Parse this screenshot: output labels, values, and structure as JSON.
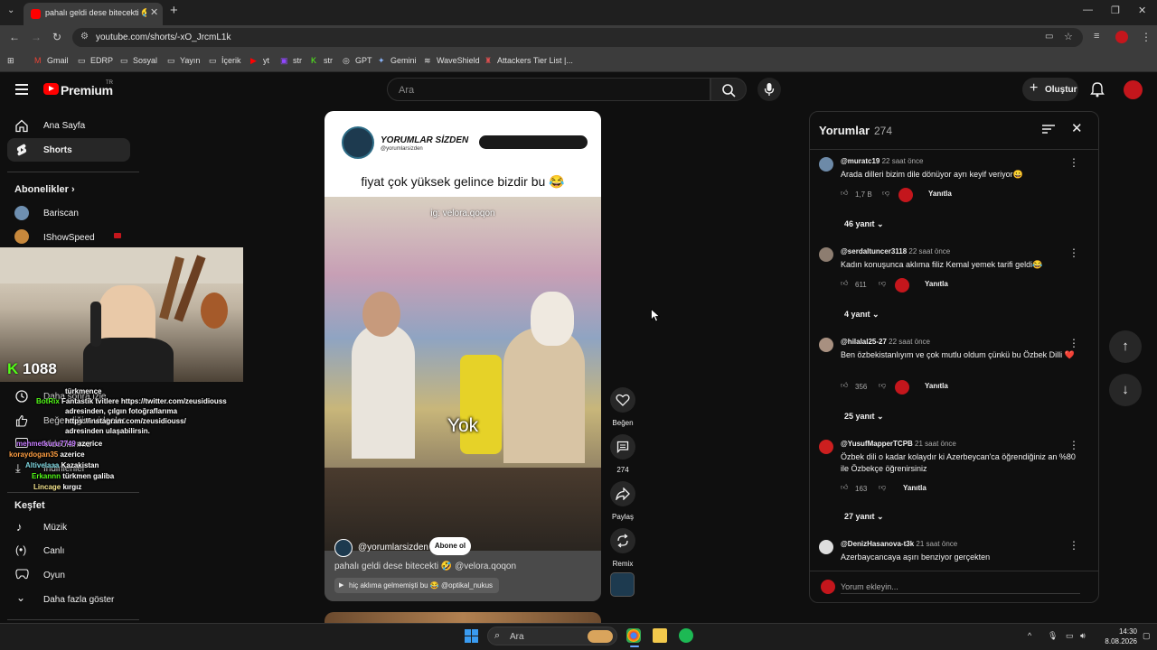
{
  "browser": {
    "tab_title": "pahalı geldi dese bitecekti 🤣",
    "url": "youtube.com/shorts/-xO_JrcmL1k",
    "bookmarks": [
      "Gmail",
      "EDRP",
      "Sosyal",
      "Yayın",
      "İçerik",
      "yt",
      "str",
      "str",
      "GPT",
      "Gemini",
      "WaveShield",
      "Attackers Tier List |..."
    ]
  },
  "header": {
    "logo": "Premium",
    "region": "TR",
    "search_placeholder": "Ara",
    "create_label": "Oluştur"
  },
  "sidebar": {
    "main": [
      "Ana Sayfa",
      "Shorts"
    ],
    "subscriptions_title": "Abonelikler",
    "subscriptions": [
      "Bariscan",
      "IShowSpeed"
    ],
    "you": [
      "Daha sonra izle",
      "Beğendiğim videolar",
      "Videolarınız",
      "İndirilenler"
    ],
    "explore_title": "Keşfet",
    "explore": [
      "Müzik",
      "Canlı",
      "Oyun"
    ],
    "show_more": "Daha fazla göster"
  },
  "stream_overlay": {
    "kick_label": "K",
    "viewers": "1088",
    "chat": [
      {
        "user": "",
        "msg": "türkmence"
      },
      {
        "user": "BotRix",
        "msg": "Fantastik tvitlere https://twitter.com/zeusidiouss"
      },
      {
        "user": "",
        "msg": "adresinden, çılgın fotoğraflarıma"
      },
      {
        "user": "",
        "msg": "https://instagram.com/zeusidiouss/"
      },
      {
        "user": "",
        "msg": "adresinden ulaşabilirsin."
      },
      {
        "user": "mehmetkuru7749",
        "msg": "azerice"
      },
      {
        "user": "koraydogan35",
        "msg": "azerice"
      },
      {
        "user": "Altivelaaa",
        "msg": "Kazakistan"
      },
      {
        "user": "Erkannn",
        "msg": "türkmen galiba"
      },
      {
        "user": "Lincage",
        "msg": "kırgız"
      }
    ]
  },
  "short": {
    "overlay_channel": "YORUMLAR SİZDEN",
    "overlay_handle": "@yorumlarsizden",
    "overlay_caption": "fiyat çok yüksek gelince bizdir bu 😂",
    "ig_tag": "ig: velora.qoqon",
    "subtitle": "Yok",
    "owner": "@yorumlarsizden",
    "subscribe_label": "Abone ol",
    "title": "pahalı geldi dese bitecekti 🤣 @velora.qoqon",
    "music": "hiç aklıma gelmemişti bu 😂 @optikal_nukus"
  },
  "actions": {
    "like": "Beğen",
    "comments_count": "274",
    "share": "Paylaş",
    "remix": "Remix"
  },
  "comments_panel": {
    "title": "Yorumlar",
    "count": "274",
    "reply_label": "Yanıtla",
    "add_placeholder": "Yorum ekleyin...",
    "comments": [
      {
        "user": "@muratc19",
        "time": "22 saat önce",
        "text": "Arada dilleri bizim dile dönüyor ayrı keyif veriyor😀",
        "likes": "1,7 B",
        "replies": "46 yanıt",
        "color": "#6d8aa8"
      },
      {
        "user": "@serdaltuncer3118",
        "time": "22 saat önce",
        "text": "Kadın konuşunca aklıma filiz Kemal yemek tarifi geldi😂",
        "likes": "611",
        "replies": "4 yanıt",
        "color": "#8d7d70"
      },
      {
        "user": "@hilalal25-27",
        "time": "22 saat önce",
        "text": "Ben özbekistanlıyım ve çok mutlu oldum çünkü bu Özbek Dilli ❤️",
        "likes": "356",
        "replies": "25 yanıt",
        "color": "#a89080"
      },
      {
        "user": "@YusufMapperTCPB",
        "time": "21 saat önce",
        "text": "Özbek dili o kadar kolaydır ki Azerbeycan'ca öğrendiğiniz an %80 ile Özbekçe öğrenirsiniz",
        "likes": "163",
        "replies": "27 yanıt",
        "color": "#cc1f1f"
      },
      {
        "user": "@DenizHasanova-t3k",
        "time": "21 saat önce",
        "text": "Azerbaycancaya aşırı benziyor gerçekten",
        "likes": "",
        "replies": "",
        "color": "#dddddd"
      }
    ]
  },
  "taskbar": {
    "search_placeholder": "Ara",
    "time": "14:30",
    "date": "8.08.2026"
  }
}
